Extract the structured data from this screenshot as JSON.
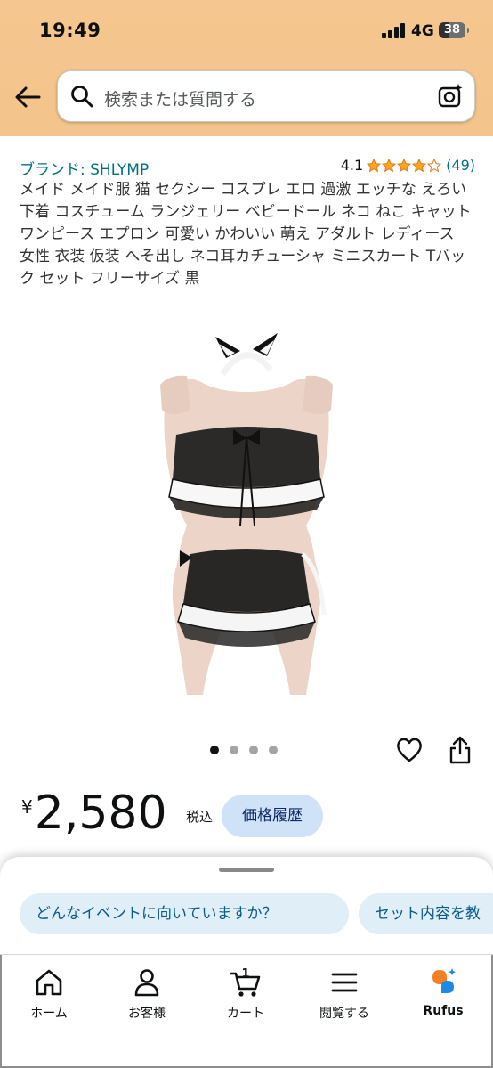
{
  "status_bar": {
    "time": "19:49",
    "network": "4G",
    "battery": "38",
    "battery_level": 0.38
  },
  "header": {
    "search_placeholder": "検索または質問する",
    "icons": [
      "back-arrow-icon",
      "search-icon",
      "camera-search-icon"
    ]
  },
  "product": {
    "brand_link": "ブランド: SHLYMP",
    "rating": "4.1",
    "rating_stars": 4.1,
    "rating_count": "(49)",
    "title": "メイド メイド服 猫 セクシー コスプレ エロ 過激 エッチな えろい 下着 コスチューム ランジェリー ベビードール ネコ ねこ キャット ワンピース エプロン 可愛い かわいい 萌え アダルト レディース 女性 衣装 仮装 へそ出し ネコ耳カチューシャ ミニスカート Tバック セット フリーサイズ 黒",
    "image_count": 4,
    "active_image": 1
  },
  "price": {
    "symbol": "¥",
    "value": "2,580",
    "tax_label": "税込",
    "history_button": "価格履歴"
  },
  "rufus": {
    "suggestions": [
      "どんなイベントに向いていますか？",
      "セット内容を教"
    ]
  },
  "tabbar": {
    "tabs": [
      {
        "label": "ホーム",
        "icon": "home-icon"
      },
      {
        "label": "お客様",
        "icon": "account-icon"
      },
      {
        "label": "カート",
        "icon": "cart-icon",
        "count": "1"
      },
      {
        "label": "閲覧する",
        "icon": "menu-icon"
      },
      {
        "label": "Rufus",
        "icon": "rufus-icon"
      }
    ]
  },
  "colors": {
    "header_bg": "#f5c68f",
    "link": "#007185",
    "star": "#ffa41c",
    "chip_bg": "#e0eef8",
    "history_button_bg": "#cfe2f7"
  }
}
